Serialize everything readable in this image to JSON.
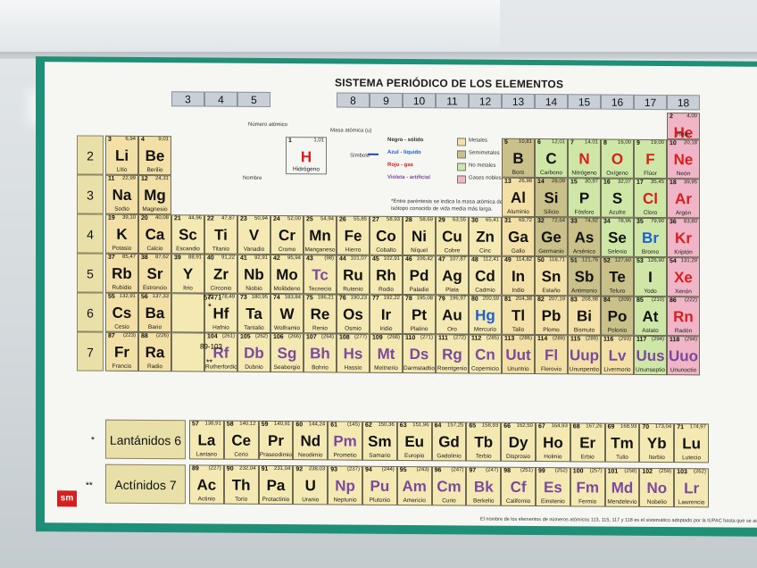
{
  "scene": {
    "title": "SISTEMA PERIÓDICO DE LOS ELEMENTOS",
    "note_parentheses": "*Entre paréntesis se indica la masa atómica del isótopo conocido de vida media más larga.",
    "footnote": "El nombre de los elementos de números atómicos 113, 115, 117 y 118 es el sistemático adoptado por la IUPAC hasta que se asignen sus no",
    "logo": "sm",
    "lanthanides_label": "Lantánidos 6",
    "actinides_label": "Actínidos 7",
    "lanthanides_marker": "*",
    "actinides_marker": "**",
    "placeholder_57_71": "57-71",
    "placeholder_89_103": "89-103",
    "star": "*",
    "star2": "**"
  },
  "key": {
    "numero_atomico": "Número atómico",
    "masa_atomica": "Masa atómica (u)",
    "simbolo": "Símbolo",
    "nombre": "Nombre",
    "example_z": "1",
    "example_mass": "1,01",
    "example_symbol": "H",
    "example_name": "Hidrógeno",
    "states": [
      "Negro - sólido",
      "Azul - líquido",
      "Rojo - gas",
      "Violeta - artificial"
    ],
    "categories": [
      "Metales",
      "Semimetales",
      "No metales",
      "Gases nobles"
    ]
  },
  "colors": {
    "metal": "#f3e0a6",
    "transition": "#f4e8b3",
    "semimetal": "#c9c08a",
    "nonmetal": "#cfe7a6",
    "halogen": "#cfe7a6",
    "noble": "#f0b6c7",
    "red": "#d81e1e",
    "blue": "#1f5fd0",
    "purple": "#7a4a9c",
    "black": "#111111"
  },
  "groups": [
    "3",
    "4",
    "5",
    "8",
    "9",
    "10",
    "11",
    "12",
    "13",
    "14",
    "15",
    "16",
    "17",
    "18"
  ],
  "periods": [
    "2",
    "3",
    "4",
    "5",
    "6",
    "7"
  ],
  "elements": [
    {
      "z": "2",
      "m": "4,00",
      "s": "He",
      "n": "Helio",
      "c": "noble",
      "t": "red",
      "r": 0,
      "g": 18
    },
    {
      "z": "3",
      "m": "6,94",
      "s": "Li",
      "n": "Litio",
      "c": "metal",
      "t": "black",
      "r": 1,
      "g": 1
    },
    {
      "z": "4",
      "m": "9,01",
      "s": "Be",
      "n": "Berilio",
      "c": "metal",
      "t": "black",
      "r": 1,
      "g": 2
    },
    {
      "z": "5",
      "m": "10,81",
      "s": "B",
      "n": "Boro",
      "c": "semimetal",
      "t": "black",
      "r": 1,
      "g": 13
    },
    {
      "z": "6",
      "m": "12,01",
      "s": "C",
      "n": "Carbono",
      "c": "nonmetal",
      "t": "black",
      "r": 1,
      "g": 14
    },
    {
      "z": "7",
      "m": "14,01",
      "s": "N",
      "n": "Nitrógeno",
      "c": "nonmetal",
      "t": "red",
      "r": 1,
      "g": 15
    },
    {
      "z": "8",
      "m": "16,00",
      "s": "O",
      "n": "Oxígeno",
      "c": "nonmetal",
      "t": "red",
      "r": 1,
      "g": 16
    },
    {
      "z": "9",
      "m": "19,00",
      "s": "F",
      "n": "Flúor",
      "c": "nonmetal",
      "t": "red",
      "r": 1,
      "g": 17
    },
    {
      "z": "10",
      "m": "20,18",
      "s": "Ne",
      "n": "Neón",
      "c": "noble",
      "t": "red",
      "r": 1,
      "g": 18
    },
    {
      "z": "11",
      "m": "22,99",
      "s": "Na",
      "n": "Sodio",
      "c": "metal",
      "t": "black",
      "r": 2,
      "g": 1
    },
    {
      "z": "12",
      "m": "24,31",
      "s": "Mg",
      "n": "Magnesio",
      "c": "metal",
      "t": "black",
      "r": 2,
      "g": 2
    },
    {
      "z": "13",
      "m": "26,98",
      "s": "Al",
      "n": "Aluminio",
      "c": "metal",
      "t": "black",
      "r": 2,
      "g": 13
    },
    {
      "z": "14",
      "m": "28,09",
      "s": "Si",
      "n": "Silicio",
      "c": "semimetal",
      "t": "black",
      "r": 2,
      "g": 14
    },
    {
      "z": "15",
      "m": "30,97",
      "s": "P",
      "n": "Fósforo",
      "c": "nonmetal",
      "t": "black",
      "r": 2,
      "g": 15
    },
    {
      "z": "16",
      "m": "32,07",
      "s": "S",
      "n": "Azufre",
      "c": "nonmetal",
      "t": "black",
      "r": 2,
      "g": 16
    },
    {
      "z": "17",
      "m": "35,45",
      "s": "Cl",
      "n": "Cloro",
      "c": "nonmetal",
      "t": "red",
      "r": 2,
      "g": 17
    },
    {
      "z": "18",
      "m": "39,95",
      "s": "Ar",
      "n": "Argón",
      "c": "noble",
      "t": "red",
      "r": 2,
      "g": 18
    },
    {
      "z": "19",
      "m": "39,10",
      "s": "K",
      "n": "Potasio",
      "c": "metal",
      "t": "black",
      "r": 3,
      "g": 1
    },
    {
      "z": "20",
      "m": "40,08",
      "s": "Ca",
      "n": "Calcio",
      "c": "metal",
      "t": "black",
      "r": 3,
      "g": 2
    },
    {
      "z": "21",
      "m": "44,96",
      "s": "Sc",
      "n": "Escandio",
      "c": "transition",
      "t": "black",
      "r": 3,
      "g": 3
    },
    {
      "z": "22",
      "m": "47,87",
      "s": "Ti",
      "n": "Titanio",
      "c": "transition",
      "t": "black",
      "r": 3,
      "g": 4
    },
    {
      "z": "23",
      "m": "50,94",
      "s": "V",
      "n": "Vanadio",
      "c": "transition",
      "t": "black",
      "r": 3,
      "g": 5
    },
    {
      "z": "24",
      "m": "52,00",
      "s": "Cr",
      "n": "Cromo",
      "c": "transition",
      "t": "black",
      "r": 3,
      "g": 6
    },
    {
      "z": "25",
      "m": "54,94",
      "s": "Mn",
      "n": "Manganeso",
      "c": "transition",
      "t": "black",
      "r": 3,
      "g": 7
    },
    {
      "z": "26",
      "m": "55,85",
      "s": "Fe",
      "n": "Hierro",
      "c": "transition",
      "t": "black",
      "r": 3,
      "g": 8
    },
    {
      "z": "27",
      "m": "58,93",
      "s": "Co",
      "n": "Cobalto",
      "c": "transition",
      "t": "black",
      "r": 3,
      "g": 9
    },
    {
      "z": "28",
      "m": "58,69",
      "s": "Ni",
      "n": "Níquel",
      "c": "transition",
      "t": "black",
      "r": 3,
      "g": 10
    },
    {
      "z": "29",
      "m": "63,55",
      "s": "Cu",
      "n": "Cobre",
      "c": "transition",
      "t": "black",
      "r": 3,
      "g": 11
    },
    {
      "z": "30",
      "m": "65,41",
      "s": "Zn",
      "n": "Cinc",
      "c": "transition",
      "t": "black",
      "r": 3,
      "g": 12
    },
    {
      "z": "31",
      "m": "69,72",
      "s": "Ga",
      "n": "Galio",
      "c": "metal",
      "t": "black",
      "r": 3,
      "g": 13
    },
    {
      "z": "32",
      "m": "72,64",
      "s": "Ge",
      "n": "Germanio",
      "c": "semimetal",
      "t": "black",
      "r": 3,
      "g": 14
    },
    {
      "z": "33",
      "m": "74,92",
      "s": "As",
      "n": "Arsénico",
      "c": "semimetal",
      "t": "black",
      "r": 3,
      "g": 15
    },
    {
      "z": "34",
      "m": "78,96",
      "s": "Se",
      "n": "Selenio",
      "c": "nonmetal",
      "t": "black",
      "r": 3,
      "g": 16
    },
    {
      "z": "35",
      "m": "79,90",
      "s": "Br",
      "n": "Bromo",
      "c": "nonmetal",
      "t": "blue",
      "r": 3,
      "g": 17
    },
    {
      "z": "36",
      "m": "83,80",
      "s": "Kr",
      "n": "Kriptón",
      "c": "noble",
      "t": "red",
      "r": 3,
      "g": 18
    },
    {
      "z": "37",
      "m": "85,47",
      "s": "Rb",
      "n": "Rubidio",
      "c": "metal",
      "t": "black",
      "r": 4,
      "g": 1
    },
    {
      "z": "38",
      "m": "87,62",
      "s": "Sr",
      "n": "Estroncio",
      "c": "metal",
      "t": "black",
      "r": 4,
      "g": 2
    },
    {
      "z": "39",
      "m": "88,91",
      "s": "Y",
      "n": "Itrio",
      "c": "transition",
      "t": "black",
      "r": 4,
      "g": 3
    },
    {
      "z": "40",
      "m": "91,22",
      "s": "Zr",
      "n": "Circonio",
      "c": "transition",
      "t": "black",
      "r": 4,
      "g": 4
    },
    {
      "z": "41",
      "m": "92,91",
      "s": "Nb",
      "n": "Niobio",
      "c": "transition",
      "t": "black",
      "r": 4,
      "g": 5
    },
    {
      "z": "42",
      "m": "95,94",
      "s": "Mo",
      "n": "Molibdeno",
      "c": "transition",
      "t": "black",
      "r": 4,
      "g": 6
    },
    {
      "z": "43",
      "m": "(98)",
      "s": "Tc",
      "n": "Tecnecio",
      "c": "transition",
      "t": "purple",
      "r": 4,
      "g": 7
    },
    {
      "z": "44",
      "m": "101,07",
      "s": "Ru",
      "n": "Rutenio",
      "c": "transition",
      "t": "black",
      "r": 4,
      "g": 8
    },
    {
      "z": "45",
      "m": "102,91",
      "s": "Rh",
      "n": "Rodio",
      "c": "transition",
      "t": "black",
      "r": 4,
      "g": 9
    },
    {
      "z": "46",
      "m": "106,42",
      "s": "Pd",
      "n": "Paladio",
      "c": "transition",
      "t": "black",
      "r": 4,
      "g": 10
    },
    {
      "z": "47",
      "m": "107,87",
      "s": "Ag",
      "n": "Plata",
      "c": "transition",
      "t": "black",
      "r": 4,
      "g": 11
    },
    {
      "z": "48",
      "m": "112,41",
      "s": "Cd",
      "n": "Cadmio",
      "c": "transition",
      "t": "black",
      "r": 4,
      "g": 12
    },
    {
      "z": "49",
      "m": "114,82",
      "s": "In",
      "n": "Indio",
      "c": "metal",
      "t": "black",
      "r": 4,
      "g": 13
    },
    {
      "z": "50",
      "m": "118,71",
      "s": "Sn",
      "n": "Estaño",
      "c": "metal",
      "t": "black",
      "r": 4,
      "g": 14
    },
    {
      "z": "51",
      "m": "121,76",
      "s": "Sb",
      "n": "Antimonio",
      "c": "semimetal",
      "t": "black",
      "r": 4,
      "g": 15
    },
    {
      "z": "52",
      "m": "127,60",
      "s": "Te",
      "n": "Teluro",
      "c": "semimetal",
      "t": "black",
      "r": 4,
      "g": 16
    },
    {
      "z": "53",
      "m": "126,90",
      "s": "I",
      "n": "Yodo",
      "c": "nonmetal",
      "t": "black",
      "r": 4,
      "g": 17
    },
    {
      "z": "54",
      "m": "131,29",
      "s": "Xe",
      "n": "Xenón",
      "c": "noble",
      "t": "red",
      "r": 4,
      "g": 18
    },
    {
      "z": "55",
      "m": "132,91",
      "s": "Cs",
      "n": "Cesio",
      "c": "metal",
      "t": "black",
      "r": 5,
      "g": 1
    },
    {
      "z": "56",
      "m": "137,33",
      "s": "Ba",
      "n": "Bario",
      "c": "metal",
      "t": "black",
      "r": 5,
      "g": 2
    },
    {
      "z": "72",
      "m": "178,49",
      "s": "Hf",
      "n": "Hafnio",
      "c": "transition",
      "t": "black",
      "r": 5,
      "g": 4
    },
    {
      "z": "73",
      "m": "180,95",
      "s": "Ta",
      "n": "Tantalio",
      "c": "transition",
      "t": "black",
      "r": 5,
      "g": 5
    },
    {
      "z": "74",
      "m": "183,84",
      "s": "W",
      "n": "Wolframio",
      "c": "transition",
      "t": "black",
      "r": 5,
      "g": 6
    },
    {
      "z": "75",
      "m": "186,21",
      "s": "Re",
      "n": "Renio",
      "c": "transition",
      "t": "black",
      "r": 5,
      "g": 7
    },
    {
      "z": "76",
      "m": "190,23",
      "s": "Os",
      "n": "Osmio",
      "c": "transition",
      "t": "black",
      "r": 5,
      "g": 8
    },
    {
      "z": "77",
      "m": "192,22",
      "s": "Ir",
      "n": "Iridio",
      "c": "transition",
      "t": "black",
      "r": 5,
      "g": 9
    },
    {
      "z": "78",
      "m": "195,08",
      "s": "Pt",
      "n": "Platino",
      "c": "transition",
      "t": "black",
      "r": 5,
      "g": 10
    },
    {
      "z": "79",
      "m": "196,97",
      "s": "Au",
      "n": "Oro",
      "c": "transition",
      "t": "black",
      "r": 5,
      "g": 11
    },
    {
      "z": "80",
      "m": "200,59",
      "s": "Hg",
      "n": "Mercurio",
      "c": "transition",
      "t": "blue",
      "r": 5,
      "g": 12
    },
    {
      "z": "81",
      "m": "204,38",
      "s": "Tl",
      "n": "Talio",
      "c": "metal",
      "t": "black",
      "r": 5,
      "g": 13
    },
    {
      "z": "82",
      "m": "207,19",
      "s": "Pb",
      "n": "Plomo",
      "c": "metal",
      "t": "black",
      "r": 5,
      "g": 14
    },
    {
      "z": "83",
      "m": "208,98",
      "s": "Bi",
      "n": "Bismuto",
      "c": "metal",
      "t": "black",
      "r": 5,
      "g": 15
    },
    {
      "z": "84",
      "m": "(209)",
      "s": "Po",
      "n": "Polonio",
      "c": "semimetal",
      "t": "black",
      "r": 5,
      "g": 16
    },
    {
      "z": "85",
      "m": "(210)",
      "s": "At",
      "n": "Astato",
      "c": "nonmetal",
      "t": "black",
      "r": 5,
      "g": 17
    },
    {
      "z": "86",
      "m": "(222)",
      "s": "Rn",
      "n": "Radón",
      "c": "noble",
      "t": "red",
      "r": 5,
      "g": 18
    },
    {
      "z": "87",
      "m": "(223)",
      "s": "Fr",
      "n": "Francio",
      "c": "metal",
      "t": "black",
      "r": 6,
      "g": 1
    },
    {
      "z": "88",
      "m": "(226)",
      "s": "Ra",
      "n": "Radio",
      "c": "metal",
      "t": "black",
      "r": 6,
      "g": 2
    },
    {
      "z": "104",
      "m": "(261)",
      "s": "Rf",
      "n": "Rutherfordio",
      "c": "transition",
      "t": "purple",
      "r": 6,
      "g": 4
    },
    {
      "z": "105",
      "m": "(262)",
      "s": "Db",
      "n": "Dubnio",
      "c": "transition",
      "t": "purple",
      "r": 6,
      "g": 5
    },
    {
      "z": "106",
      "m": "(266)",
      "s": "Sg",
      "n": "Seaborgio",
      "c": "transition",
      "t": "purple",
      "r": 6,
      "g": 6
    },
    {
      "z": "107",
      "m": "(264)",
      "s": "Bh",
      "n": "Bohrio",
      "c": "transition",
      "t": "purple",
      "r": 6,
      "g": 7
    },
    {
      "z": "108",
      "m": "(277)",
      "s": "Hs",
      "n": "Hassio",
      "c": "transition",
      "t": "purple",
      "r": 6,
      "g": 8
    },
    {
      "z": "109",
      "m": "(268)",
      "s": "Mt",
      "n": "Meitnerio",
      "c": "transition",
      "t": "purple",
      "r": 6,
      "g": 9
    },
    {
      "z": "110",
      "m": "(271)",
      "s": "Ds",
      "n": "Darmstadtio",
      "c": "transition",
      "t": "purple",
      "r": 6,
      "g": 10
    },
    {
      "z": "111",
      "m": "(272)",
      "s": "Rg",
      "n": "Roentgenio",
      "c": "transition",
      "t": "purple",
      "r": 6,
      "g": 11
    },
    {
      "z": "112",
      "m": "(285)",
      "s": "Cn",
      "n": "Copernicio",
      "c": "transition",
      "t": "purple",
      "r": 6,
      "g": 12
    },
    {
      "z": "113",
      "m": "(286)",
      "s": "Uut",
      "n": "Ununtrio",
      "c": "metal",
      "t": "purple",
      "r": 6,
      "g": 13
    },
    {
      "z": "114",
      "m": "(289)",
      "s": "Fl",
      "n": "Flerovio",
      "c": "metal",
      "t": "purple",
      "r": 6,
      "g": 14
    },
    {
      "z": "115",
      "m": "(289)",
      "s": "Uup",
      "n": "Ununpentio",
      "c": "metal",
      "t": "purple",
      "r": 6,
      "g": 15
    },
    {
      "z": "116",
      "m": "(293)",
      "s": "Lv",
      "n": "Livermorio",
      "c": "metal",
      "t": "purple",
      "r": 6,
      "g": 16
    },
    {
      "z": "117",
      "m": "(294)",
      "s": "Uus",
      "n": "Ununseptio",
      "c": "nonmetal",
      "t": "purple",
      "r": 6,
      "g": 17
    },
    {
      "z": "118",
      "m": "(294)",
      "s": "Uuo",
      "n": "Ununoctio",
      "c": "noble",
      "t": "purple",
      "r": 6,
      "g": 18
    }
  ],
  "lanthanides": [
    {
      "z": "57",
      "m": "138,91",
      "s": "La",
      "n": "Lantano",
      "t": "black"
    },
    {
      "z": "58",
      "m": "140,12",
      "s": "Ce",
      "n": "Cerio",
      "t": "black"
    },
    {
      "z": "59",
      "m": "140,91",
      "s": "Pr",
      "n": "Praseodimio",
      "t": "black"
    },
    {
      "z": "60",
      "m": "144,24",
      "s": "Nd",
      "n": "Neodimio",
      "t": "black"
    },
    {
      "z": "61",
      "m": "(145)",
      "s": "Pm",
      "n": "Prometio",
      "t": "purple"
    },
    {
      "z": "62",
      "m": "150,36",
      "s": "Sm",
      "n": "Samario",
      "t": "black"
    },
    {
      "z": "63",
      "m": "151,96",
      "s": "Eu",
      "n": "Europio",
      "t": "black"
    },
    {
      "z": "64",
      "m": "157,25",
      "s": "Gd",
      "n": "Gadolinio",
      "t": "black"
    },
    {
      "z": "65",
      "m": "158,93",
      "s": "Tb",
      "n": "Terbio",
      "t": "black"
    },
    {
      "z": "66",
      "m": "162,50",
      "s": "Dy",
      "n": "Disprosio",
      "t": "black"
    },
    {
      "z": "67",
      "m": "164,93",
      "s": "Ho",
      "n": "Holmio",
      "t": "black"
    },
    {
      "z": "68",
      "m": "167,26",
      "s": "Er",
      "n": "Erbio",
      "t": "black"
    },
    {
      "z": "69",
      "m": "168,93",
      "s": "Tm",
      "n": "Tulio",
      "t": "black"
    },
    {
      "z": "70",
      "m": "173,04",
      "s": "Yb",
      "n": "Iterbio",
      "t": "black"
    },
    {
      "z": "71",
      "m": "174,97",
      "s": "Lu",
      "n": "Lutecio",
      "t": "black"
    }
  ],
  "actinides": [
    {
      "z": "89",
      "m": "(227)",
      "s": "Ac",
      "n": "Actinio",
      "t": "black"
    },
    {
      "z": "90",
      "m": "232,04",
      "s": "Th",
      "n": "Torio",
      "t": "black"
    },
    {
      "z": "91",
      "m": "231,04",
      "s": "Pa",
      "n": "Protactinio",
      "t": "black"
    },
    {
      "z": "92",
      "m": "238,03",
      "s": "U",
      "n": "Uranio",
      "t": "black"
    },
    {
      "z": "93",
      "m": "(237)",
      "s": "Np",
      "n": "Neptunio",
      "t": "purple"
    },
    {
      "z": "94",
      "m": "(244)",
      "s": "Pu",
      "n": "Plutonio",
      "t": "purple"
    },
    {
      "z": "95",
      "m": "(243)",
      "s": "Am",
      "n": "Americio",
      "t": "purple"
    },
    {
      "z": "96",
      "m": "(247)",
      "s": "Cm",
      "n": "Curio",
      "t": "purple"
    },
    {
      "z": "97",
      "m": "(247)",
      "s": "Bk",
      "n": "Berkelio",
      "t": "purple"
    },
    {
      "z": "98",
      "m": "(251)",
      "s": "Cf",
      "n": "Californio",
      "t": "purple"
    },
    {
      "z": "99",
      "m": "(252)",
      "s": "Es",
      "n": "Einstenio",
      "t": "purple"
    },
    {
      "z": "100",
      "m": "(257)",
      "s": "Fm",
      "n": "Fermio",
      "t": "purple"
    },
    {
      "z": "101",
      "m": "(258)",
      "s": "Md",
      "n": "Mendelevio",
      "t": "purple"
    },
    {
      "z": "102",
      "m": "(259)",
      "s": "No",
      "n": "Nobelio",
      "t": "purple"
    },
    {
      "z": "103",
      "m": "(262)",
      "s": "Lr",
      "n": "Lawrencio",
      "t": "purple"
    }
  ]
}
